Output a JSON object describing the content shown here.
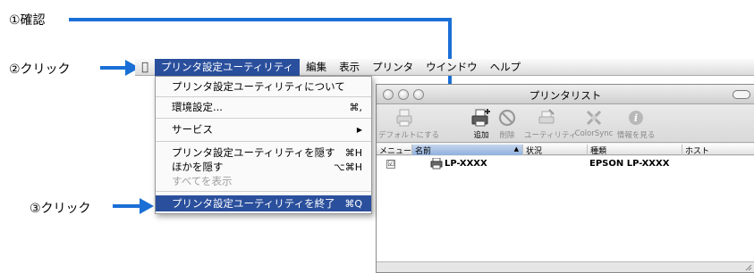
{
  "annotations": {
    "step1": "①確認",
    "step2": "②クリック",
    "step3": "③クリック"
  },
  "menubar": {
    "apple_icon": "apple-icon",
    "items": [
      "プリンタ設定ユーティリティ",
      "編集",
      "表示",
      "プリンタ",
      "ウインドウ",
      "ヘルプ"
    ]
  },
  "app_menu": {
    "about": "プリンタ設定ユーティリティについて",
    "preferences": "環境設定...",
    "preferences_shortcut": "⌘,",
    "services": "サービス",
    "services_arrow": "▶",
    "hide_app": "プリンタ設定ユーティリティを隠す",
    "hide_app_shortcut": "⌘H",
    "hide_others": "ほかを隠す",
    "hide_others_shortcut": "⌥⌘H",
    "show_all": "すべてを表示",
    "quit": "プリンタ設定ユーティリティを終了",
    "quit_shortcut": "⌘Q"
  },
  "window": {
    "title": "プリンタリスト",
    "toolbar": {
      "default": "デフォルトにする",
      "add": "追加",
      "delete": "削除",
      "utility": "ユーティリティ",
      "colorsync": "ColorSync",
      "info": "情報を見る"
    },
    "columns": {
      "menu": "メニュー",
      "name": "名前",
      "status": "状況",
      "kind": "種類",
      "host": "ホスト"
    },
    "rows": [
      {
        "checked": "☑",
        "name": "LP-XXXX",
        "status": "",
        "kind": "EPSON LP-XXXX",
        "host": ""
      }
    ]
  },
  "colors": {
    "accent": "#1a6fd6",
    "menu_highlight": "#2a4f9c"
  }
}
